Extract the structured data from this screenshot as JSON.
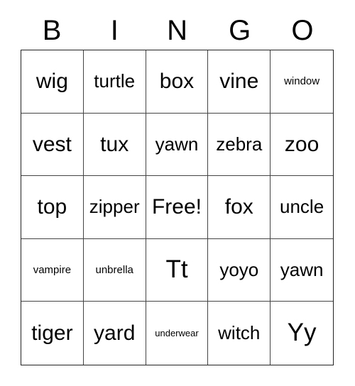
{
  "card": {
    "header": {
      "letters": [
        "B",
        "I",
        "N",
        "G",
        "O"
      ]
    },
    "grid": {
      "columns": 5,
      "rows": 5,
      "cells": [
        {
          "text": "wig",
          "size": "lg"
        },
        {
          "text": "turtle",
          "size": "md"
        },
        {
          "text": "box",
          "size": "lg"
        },
        {
          "text": "vine",
          "size": "lg"
        },
        {
          "text": "window",
          "size": "xs"
        },
        {
          "text": "vest",
          "size": "lg"
        },
        {
          "text": "tux",
          "size": "lg"
        },
        {
          "text": "yawn",
          "size": "md"
        },
        {
          "text": "zebra",
          "size": "md"
        },
        {
          "text": "zoo",
          "size": "lg"
        },
        {
          "text": "top",
          "size": "lg"
        },
        {
          "text": "zipper",
          "size": "md"
        },
        {
          "text": "Free!",
          "size": "lg"
        },
        {
          "text": "fox",
          "size": "lg"
        },
        {
          "text": "uncle",
          "size": "md"
        },
        {
          "text": "vampire",
          "size": "xs"
        },
        {
          "text": "unbrella",
          "size": "xs"
        },
        {
          "text": "Tt",
          "size": "xl"
        },
        {
          "text": "yoyo",
          "size": "md"
        },
        {
          "text": "yawn",
          "size": "md"
        },
        {
          "text": "tiger",
          "size": "lg"
        },
        {
          "text": "yard",
          "size": "lg"
        },
        {
          "text": "underwear",
          "size": "xxs"
        },
        {
          "text": "witch",
          "size": "md"
        },
        {
          "text": "Yy",
          "size": "xl"
        }
      ]
    }
  }
}
